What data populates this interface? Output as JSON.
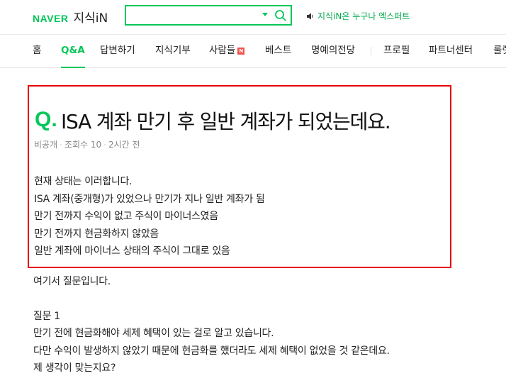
{
  "header": {
    "logo_brand": "NAVER",
    "logo_service": "지식iN",
    "search": {
      "value": "",
      "placeholder": ""
    },
    "promo_text": "지식iN은 누구나 엑스퍼트"
  },
  "nav": {
    "items": [
      {
        "label": "홈"
      },
      {
        "label": "Q&A"
      },
      {
        "label": "답변하기"
      },
      {
        "label": "지식기부"
      },
      {
        "label": "사람들",
        "badge": "N"
      },
      {
        "label": "베스트"
      },
      {
        "label": "명예의전당"
      },
      {
        "label": "프로필"
      },
      {
        "label": "파트너센터"
      },
      {
        "label": "룰렛"
      }
    ],
    "active_index": 1
  },
  "question": {
    "mark": "Q.",
    "title": "ISA 계좌 만기 후 일반 계좌가 되었는데요.",
    "meta": {
      "author": "비공개",
      "views": "조회수 10",
      "time": "2시간 전"
    },
    "body_lines": [
      "현재 상태는 이러합니다.",
      "ISA 계좌(중개형)가 있었으나 만기가 지나 일반 계좌가 됨",
      "만기 전까지 수익이 없고 주식이 마이너스였음",
      "만기 전까지 현금화하지 않았음",
      "일반 계좌에 마이너스 상태의 주식이 그대로 있음"
    ]
  },
  "continuation": {
    "intro": "여기서 질문입니다.",
    "q1_heading": "질문 1",
    "q1_lines": [
      "만기 전에 현금화해야 세제 혜택이 있는 걸로 알고 있습니다.",
      "다만 수익이 발생하지 않았기 때문에 현금화를 했더라도 세제 혜택이 없었을 것 같은데요.",
      "제 생각이 맞는지요?"
    ]
  },
  "colors": {
    "brand": "#03c75a",
    "highlight_border": "#e60000"
  }
}
